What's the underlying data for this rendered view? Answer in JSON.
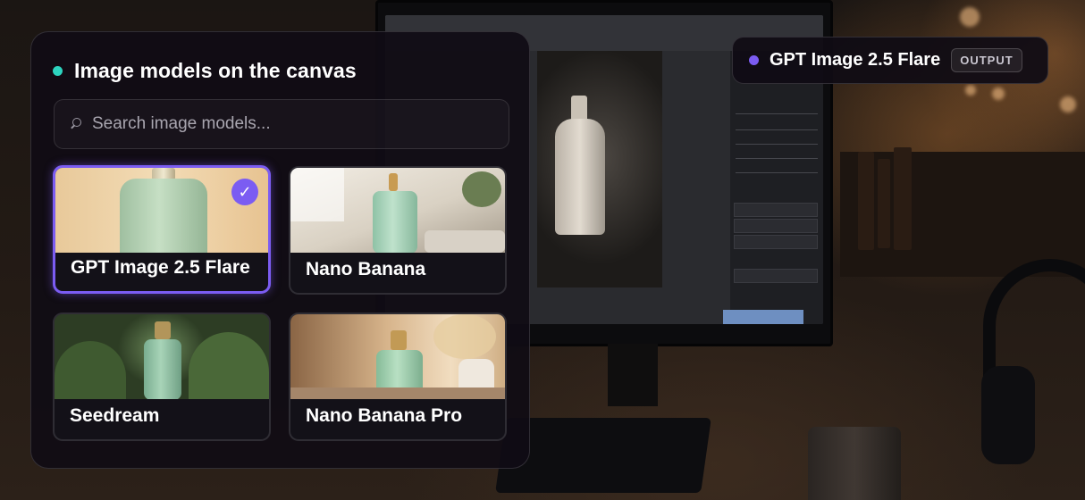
{
  "colors": {
    "header_dot": "#2dd4bf",
    "selected_accent": "#7b5cf2",
    "output_dot": "#7b5cf2"
  },
  "panel": {
    "title": "Image models on the canvas",
    "search": {
      "placeholder": "Search image models...",
      "value": ""
    },
    "models": [
      {
        "label": "GPT Image 2.5 Flare",
        "selected": true,
        "icon": "check-icon"
      },
      {
        "label": "Nano Banana",
        "selected": false
      },
      {
        "label": "Seedream",
        "selected": false
      },
      {
        "label": "Nano Banana Pro",
        "selected": false
      }
    ]
  },
  "output_badge": {
    "model": "GPT Image 2.5 Flare",
    "tag": "OUTPUT"
  },
  "check_symbol": "✓"
}
